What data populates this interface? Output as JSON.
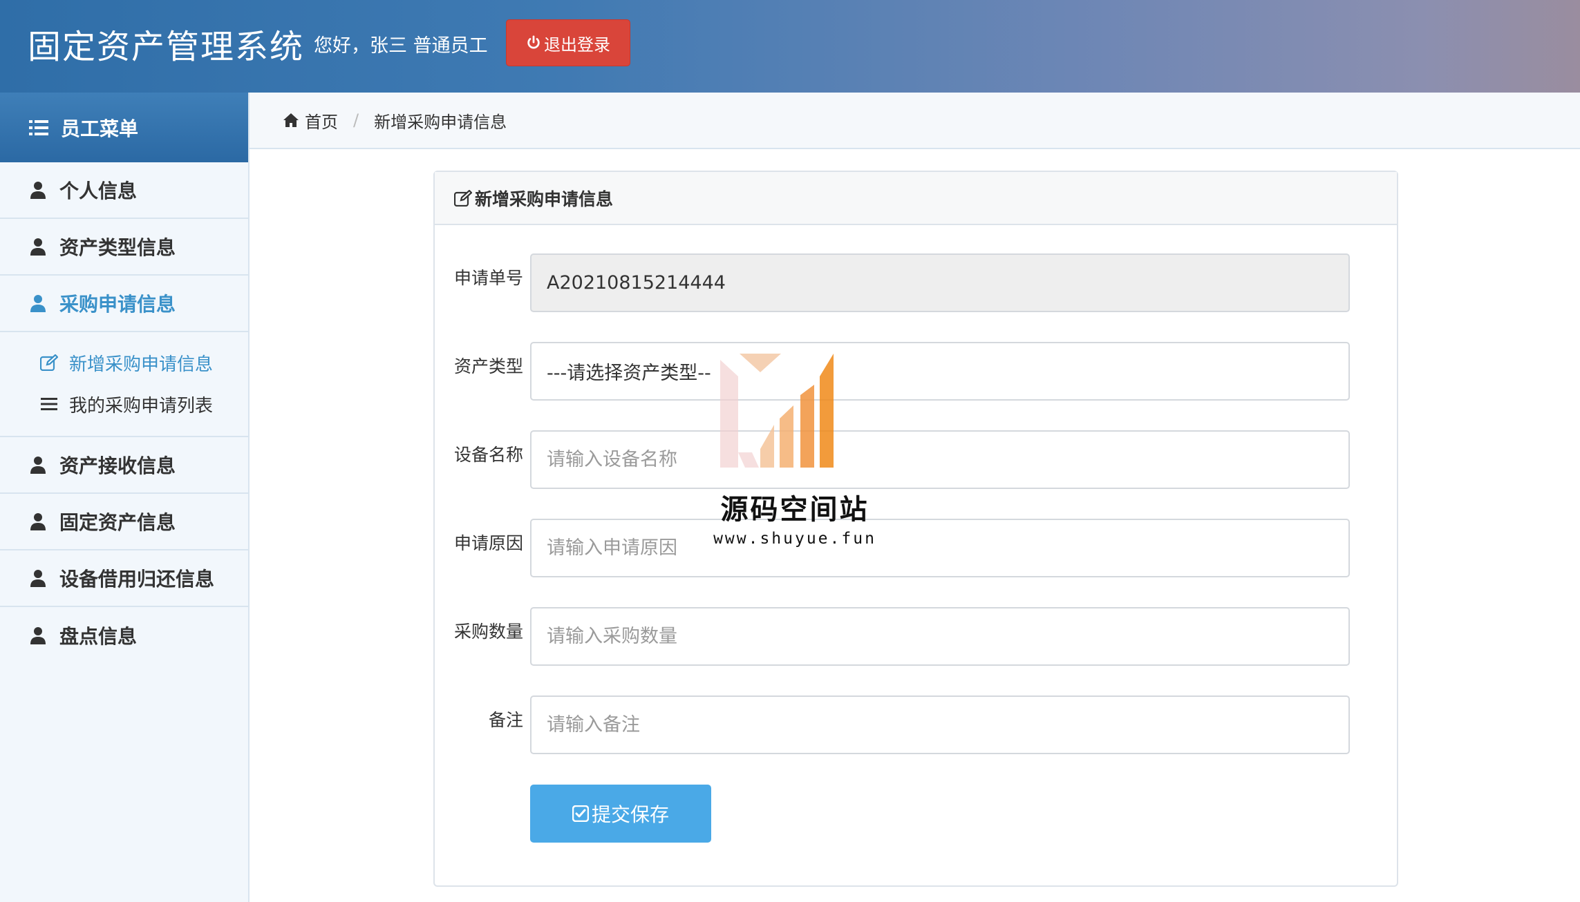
{
  "header": {
    "app_title": "固定资产管理系统",
    "greeting": "您好，张三  普通员工",
    "logout_label": "退出登录"
  },
  "sidebar": {
    "title": "员工菜单",
    "items": [
      {
        "label": "个人信息"
      },
      {
        "label": "资产类型信息"
      },
      {
        "label": "采购申请信息",
        "active": true
      },
      {
        "label": "资产接收信息"
      },
      {
        "label": "固定资产信息"
      },
      {
        "label": "设备借用归还信息"
      },
      {
        "label": "盘点信息"
      }
    ],
    "sub_items": [
      {
        "label": "新增采购申请信息",
        "active": true
      },
      {
        "label": "我的采购申请列表"
      }
    ]
  },
  "breadcrumb": {
    "home": "首页",
    "current": "新增采购申请信息"
  },
  "panel": {
    "title": "新增采购申请信息"
  },
  "form": {
    "apply_no": {
      "label": "申请单号",
      "value": "A20210815214444"
    },
    "asset_type": {
      "label": "资产类型",
      "value": "---请选择资产类型--"
    },
    "device_name": {
      "label": "设备名称",
      "placeholder": "请输入设备名称"
    },
    "reason": {
      "label": "申请原因",
      "placeholder": "请输入申请原因"
    },
    "quantity": {
      "label": "采购数量",
      "placeholder": "请输入采购数量"
    },
    "remark": {
      "label": "备注",
      "placeholder": "请输入备注"
    },
    "submit_label": "提交保存"
  },
  "watermark": {
    "title": "源码空间站",
    "url": "www.shuyue.fun"
  },
  "colors": {
    "header_start": "#2f6ea8",
    "logout": "#d9453a",
    "accent": "#3a91c9",
    "submit": "#4aa9e7"
  }
}
